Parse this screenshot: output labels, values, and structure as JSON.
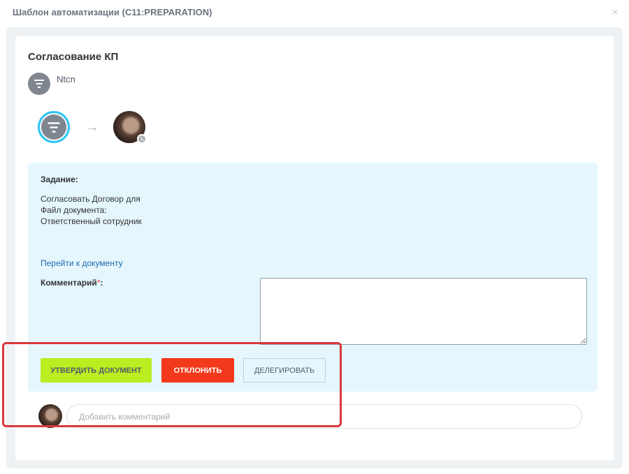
{
  "dialog": {
    "title": "Шаблон автоматизации (C11:PREPARATION)",
    "close_glyph": "×"
  },
  "card": {
    "title": "Согласование КП",
    "author_name": "Ntcn",
    "arrow_glyph": "→"
  },
  "task": {
    "label": "Задание:",
    "lines": [
      "Согласовать Договор для",
      "Файл документа:",
      "Ответственный сотрудник"
    ],
    "document_link": "Перейти к документу",
    "comment_label": "Комментарий",
    "comment_required_mark": "*",
    "comment_label_suffix": ":",
    "comment_value": ""
  },
  "actions": {
    "approve_label": "Утвердить документ",
    "reject_label": "Отклонить",
    "delegate_label": "Делегировать"
  },
  "comments": {
    "add_placeholder": "Добавить комментарий",
    "add_value": ""
  },
  "icons": {
    "author": "filter-icon",
    "step": "filter-icon",
    "badge": "clock-icon",
    "close": "close-icon"
  },
  "colors": {
    "accent_ring": "#2fc6f6",
    "approve": "#bbed21",
    "reject": "#f2391c",
    "task_bg": "#e5f7fd",
    "link": "#2067b0",
    "highlight": "#d9393b"
  }
}
